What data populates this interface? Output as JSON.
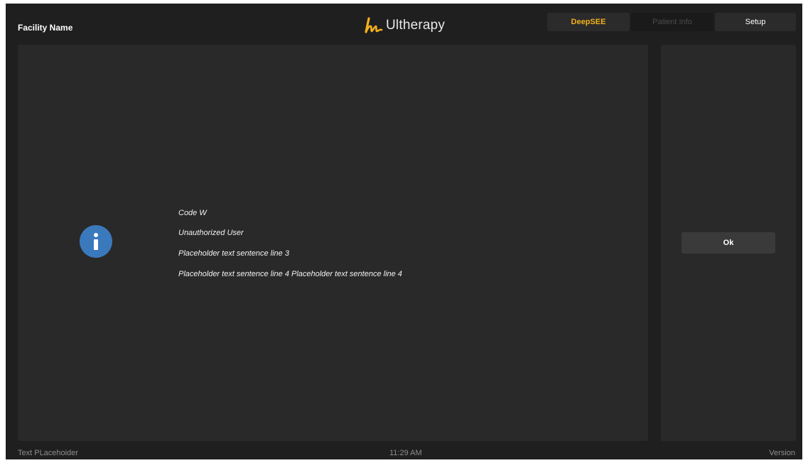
{
  "header": {
    "facility_name": "Facility Name",
    "brand": {
      "name": "Ultherapy",
      "logo_icon": "ultherapy-swoosh-logo",
      "logo_color": "#f2b01e"
    },
    "tabs": [
      {
        "label": "DeepSEE",
        "state": "active",
        "color": "#f2b01e"
      },
      {
        "label": "Patient Info",
        "state": "disabled"
      },
      {
        "label": "Setup",
        "state": "enabled"
      }
    ]
  },
  "dialog": {
    "icon": "info-icon",
    "icon_color": "#3b79bd",
    "lines": [
      "Code W",
      "Unauthorized User",
      "Placeholder text sentence line 3",
      "Placeholder text sentence line 4 Placeholder text sentence line 4"
    ],
    "ok_label": "Ok"
  },
  "footer": {
    "left_text": "Text PLacehoider",
    "time": "11:29 AM",
    "version": "Version"
  }
}
